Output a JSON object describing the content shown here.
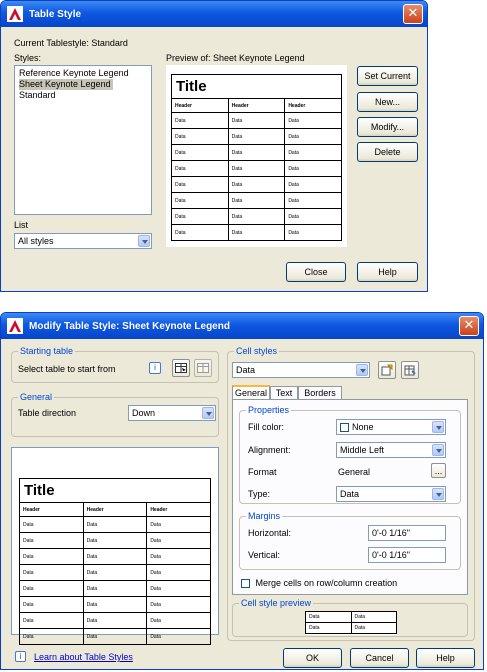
{
  "dialog1": {
    "title": "Table Style",
    "current_label": "Current Tablestyle: Standard",
    "styles_label": "Styles:",
    "styles": [
      "Reference Keynote Legend",
      "Sheet Keynote Legend",
      "Standard"
    ],
    "selected_style_index": 1,
    "preview_label": "Preview of: Sheet Keynote Legend",
    "list_label": "List",
    "list_value": "All styles",
    "buttons": {
      "set_current": "Set Current",
      "new": "New...",
      "modify": "Modify...",
      "delete": "Delete",
      "close": "Close",
      "help": "Help"
    },
    "preview": {
      "title": "Title",
      "headers": [
        "Header",
        "Header",
        "Header"
      ],
      "rows": [
        [
          "Data",
          "Data",
          "Data"
        ],
        [
          "Data",
          "Data",
          "Data"
        ],
        [
          "Data",
          "Data",
          "Data"
        ],
        [
          "Data",
          "Data",
          "Data"
        ],
        [
          "Data",
          "Data",
          "Data"
        ],
        [
          "Data",
          "Data",
          "Data"
        ],
        [
          "Data",
          "Data",
          "Data"
        ],
        [
          "Data",
          "Data",
          "Data"
        ]
      ]
    }
  },
  "dialog2": {
    "title": "Modify Table Style: Sheet Keynote Legend",
    "starting_table": {
      "label": "Starting table",
      "text": "Select table to start from"
    },
    "general": {
      "label": "General",
      "direction_label": "Table direction",
      "direction_value": "Down"
    },
    "cell_styles": {
      "label": "Cell styles",
      "value": "Data"
    },
    "tabs": [
      "General",
      "Text",
      "Borders"
    ],
    "properties": {
      "label": "Properties",
      "fill_color_label": "Fill color:",
      "fill_color_value": "None",
      "alignment_label": "Alignment:",
      "alignment_value": "Middle Left",
      "format_label": "Format",
      "format_value": "General",
      "format_btn": "...",
      "type_label": "Type:",
      "type_value": "Data"
    },
    "margins": {
      "label": "Margins",
      "horizontal_label": "Horizontal:",
      "horizontal_value": "0'-0 1/16\"",
      "vertical_label": "Vertical:",
      "vertical_value": "0'-0 1/16\""
    },
    "merge_label": "Merge cells on row/column creation",
    "cell_preview": {
      "label": "Cell style preview",
      "cells": [
        [
          "Data",
          "Data"
        ],
        [
          "Data",
          "Data"
        ]
      ]
    },
    "learn_link": "Learn about Table Styles",
    "buttons": {
      "ok": "OK",
      "cancel": "Cancel",
      "help": "Help"
    },
    "preview": {
      "title": "Title",
      "headers": [
        "Header",
        "Header",
        "Header"
      ],
      "rows": [
        [
          "Data",
          "Data",
          "Data"
        ],
        [
          "Data",
          "Data",
          "Data"
        ],
        [
          "Data",
          "Data",
          "Data"
        ],
        [
          "Data",
          "Data",
          "Data"
        ],
        [
          "Data",
          "Data",
          "Data"
        ],
        [
          "Data",
          "Data",
          "Data"
        ],
        [
          "Data",
          "Data",
          "Data"
        ],
        [
          "Data",
          "Data",
          "Data"
        ]
      ]
    }
  }
}
